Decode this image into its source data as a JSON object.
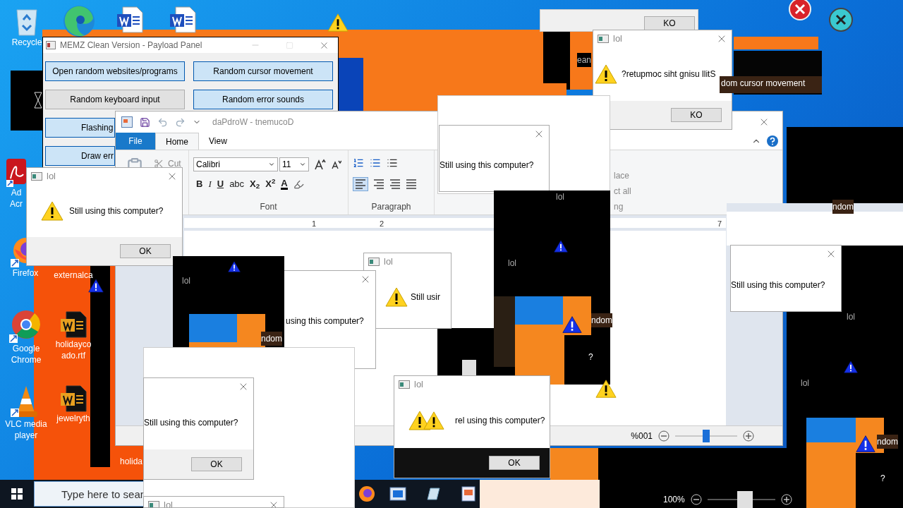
{
  "desktop_icons": [
    {
      "kind": "recycle",
      "lines": [
        "Recycle"
      ]
    },
    {
      "kind": "edge"
    },
    {
      "kind": "word"
    },
    {
      "kind": "word"
    },
    {
      "kind": "acrobat",
      "lines": [
        "Ad",
        "Acr"
      ]
    },
    {
      "kind": "firefox",
      "lines": [
        "Firefox"
      ]
    },
    {
      "kind": "chrome",
      "lines": [
        "Google",
        "Chrome"
      ]
    },
    {
      "kind": "vlc",
      "lines": [
        "VLC media",
        "player"
      ]
    },
    {
      "kind": "label",
      "lines": [
        "externalca"
      ]
    },
    {
      "kind": "word_dark",
      "lines": [
        "holidayco",
        "ado.rtf"
      ]
    },
    {
      "kind": "word_dark",
      "lines": [
        "jewelryth"
      ]
    },
    {
      "kind": "label",
      "lines": [
        "holida"
      ]
    }
  ],
  "payload_panel": {
    "title": "MEMZ Clean Version - Payload Panel",
    "buttons": [
      {
        "label": "Open random websites/programs",
        "active": true
      },
      {
        "label": "Random cursor movement",
        "active": true
      },
      {
        "label": "Random keyboard input",
        "active": false
      },
      {
        "label": "Random error sounds",
        "active": true
      },
      {
        "label": "Flashing",
        "active": true
      },
      {
        "label": "Draw err",
        "active": true
      }
    ]
  },
  "wordpad": {
    "title": "daPdroW - tnemucoD",
    "tabs": [
      {
        "label": "File",
        "kind": "app_menu",
        "selected": false
      },
      {
        "label": "Home",
        "kind": "tab",
        "selected": true
      },
      {
        "label": "View",
        "kind": "tab",
        "selected": false
      }
    ],
    "cut": "Cut",
    "font": "Calibri",
    "size": "11",
    "format_buttons": [
      {
        "label": "B",
        "kind": "bold"
      },
      {
        "label": "I",
        "kind": "italic"
      },
      {
        "label": "U",
        "kind": "underline"
      },
      {
        "label": "abc",
        "kind": "strike"
      },
      {
        "label": "X$_{2}$",
        "kind": "plain"
      },
      {
        "label": "X$^{2}$",
        "kind": "plain"
      },
      {
        "label": "A",
        "kind": "color"
      }
    ],
    "groups": [
      "Font",
      "Paragraph"
    ],
    "editing_fragments": [
      "lace",
      "ct all",
      "ng"
    ],
    "ruler_marks": [
      "1",
      "2",
      "7"
    ],
    "zoom": "%001",
    "level": 0.5
  },
  "dialogs": [
    {
      "title": "lol",
      "message": "Still using this computer?",
      "button": "OK"
    },
    {
      "button": "KO"
    },
    {
      "title": "lol",
      "message": "?retupmoc siht gnisu llitS",
      "button": "KO"
    },
    {
      "message": "Still using this computer?"
    },
    {
      "message": "using this computer?"
    },
    {
      "title": "lol",
      "message": "Still usir"
    },
    {
      "message": "Still using this computer?",
      "button": "OK"
    },
    {
      "title": "lol",
      "message": "rel using this computer?",
      "button": "OK"
    },
    {
      "message": "Still using this computer?"
    },
    {
      "title": "lol"
    }
  ],
  "fragment_texts": [
    "ean",
    "dom cursor movement",
    "lol",
    "lol",
    "lol",
    "lol",
    "lol",
    "ndom",
    "ndom",
    "ndom",
    "ndom",
    "?",
    "?"
  ],
  "taskbar": {
    "search": {
      "placeholder": "Type here to sear"
    }
  },
  "second_zoom": {
    "label": "100%",
    "level": 0.55
  }
}
